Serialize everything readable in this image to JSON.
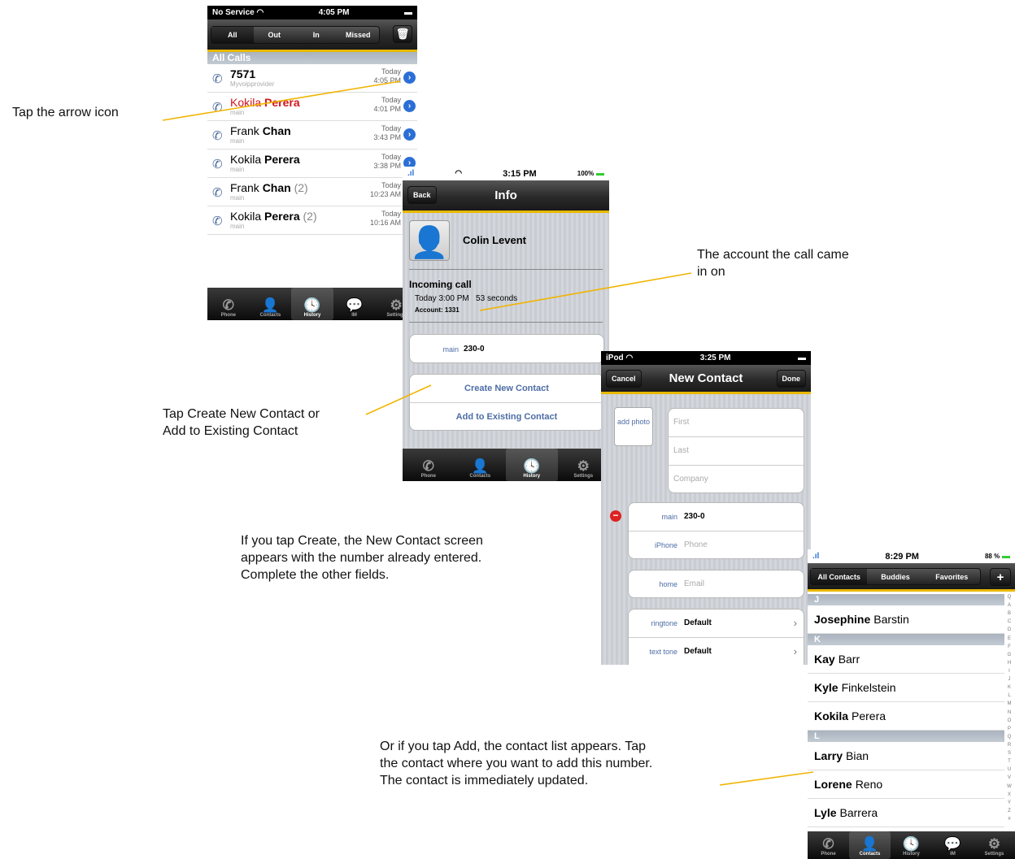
{
  "history": {
    "status": {
      "carrier": "No Service",
      "time": "4:05 PM"
    },
    "segments": [
      "All",
      "Out",
      "In",
      "Missed"
    ],
    "section": "All Calls",
    "rows": [
      {
        "first": "",
        "last": "7571",
        "count": "",
        "sub": "Myvoipprovider",
        "day": "Today",
        "time": "4:05 PM",
        "missed": false
      },
      {
        "first": "Kokila",
        "last": "Perera",
        "count": "",
        "sub": "main",
        "day": "Today",
        "time": "4:01 PM",
        "missed": true
      },
      {
        "first": "Frank",
        "last": "Chan",
        "count": "",
        "sub": "main",
        "day": "Today",
        "time": "3:43 PM",
        "missed": false
      },
      {
        "first": "Kokila",
        "last": "Perera",
        "count": "",
        "sub": "main",
        "day": "Today",
        "time": "3:38 PM",
        "missed": false
      },
      {
        "first": "Frank",
        "last": "Chan",
        "count": "(2)",
        "sub": "main",
        "day": "Today",
        "time": "10:23 AM",
        "missed": false
      },
      {
        "first": "Kokila",
        "last": "Perera",
        "count": "(2)",
        "sub": "main",
        "day": "Today",
        "time": "10:16 AM",
        "missed": false
      }
    ],
    "tabs": [
      "Phone",
      "Contacts",
      "History",
      "IM",
      "Settings"
    ]
  },
  "info": {
    "status": {
      "time": "3:15 PM",
      "battery": "100%"
    },
    "back": "Back",
    "title": "Info",
    "contact_name": "Colin Levent",
    "call_type": "Incoming call",
    "call_detail": "Today 3:00 PM   53 seconds",
    "account": "Account: 1331",
    "number_label": "main",
    "number": "230-0",
    "create": "Create New Contact",
    "add": "Add to Existing Contact",
    "tabs": [
      "Phone",
      "Contacts",
      "History",
      "Settings"
    ]
  },
  "new_contact": {
    "status": {
      "device": "iPod",
      "time": "3:25 PM"
    },
    "cancel": "Cancel",
    "title": "New Contact",
    "done": "Done",
    "add_photo": "add photo",
    "first_ph": "First",
    "last_ph": "Last",
    "company_ph": "Company",
    "main_label": "main",
    "main_value": "230-0",
    "iphone_label": "iPhone",
    "phone_ph": "Phone",
    "home_label": "home",
    "email_ph": "Email",
    "ringtone_label": "ringtone",
    "ringtone_value": "Default",
    "texttone_label": "text tone",
    "texttone_value": "Default"
  },
  "contacts": {
    "status": {
      "time": "8:29 PM",
      "battery": "88 %"
    },
    "segments": [
      "All Contacts",
      "Buddies",
      "Favorites"
    ],
    "add": "+",
    "list": [
      {
        "type": "section",
        "text": "J"
      },
      {
        "type": "row",
        "first": "Josephine",
        "last": "Barstin"
      },
      {
        "type": "section",
        "text": "K"
      },
      {
        "type": "row",
        "first": "Kay",
        "last": "Barr"
      },
      {
        "type": "row",
        "first": "Kyle",
        "last": "Finkelstein"
      },
      {
        "type": "row",
        "first": "Kokila",
        "last": "Perera"
      },
      {
        "type": "section",
        "text": "L"
      },
      {
        "type": "row",
        "first": "Larry",
        "last": "Bian"
      },
      {
        "type": "row",
        "first": "Lorene",
        "last": "Reno"
      },
      {
        "type": "row",
        "first": "Lyle",
        "last": "Barrera"
      }
    ],
    "index": [
      "Q",
      "A",
      "B",
      "C",
      "D",
      "E",
      "F",
      "G",
      "H",
      "I",
      "J",
      "K",
      "L",
      "M",
      "N",
      "O",
      "P",
      "Q",
      "R",
      "S",
      "T",
      "U",
      "V",
      "W",
      "X",
      "Y",
      "Z",
      "#"
    ],
    "tabs": [
      "Phone",
      "Contacts",
      "History",
      "IM",
      "Settings"
    ]
  },
  "annotations": {
    "a1": "Tap the arrow icon",
    "a2_l1": "The account the call came",
    "a2_l2": "in on",
    "a3_l1": "Tap Create New Contact or",
    "a3_l2": "Add to Existing Contact",
    "a4_l1": "If you tap Create, the New Contact screen",
    "a4_l2": "appears with the number already entered.",
    "a4_l3": "Complete the other fields.",
    "a5_l1": "Or if you tap Add, the contact list appears. Tap",
    "a5_l2": "the contact where you want to add this number.",
    "a5_l3": "The contact is immediately updated."
  },
  "colors": {
    "accent": "#e8b800",
    "link_blue": "#4d6da6",
    "missed_red": "#d0141b",
    "disclosure_blue": "#2b6fd6"
  }
}
